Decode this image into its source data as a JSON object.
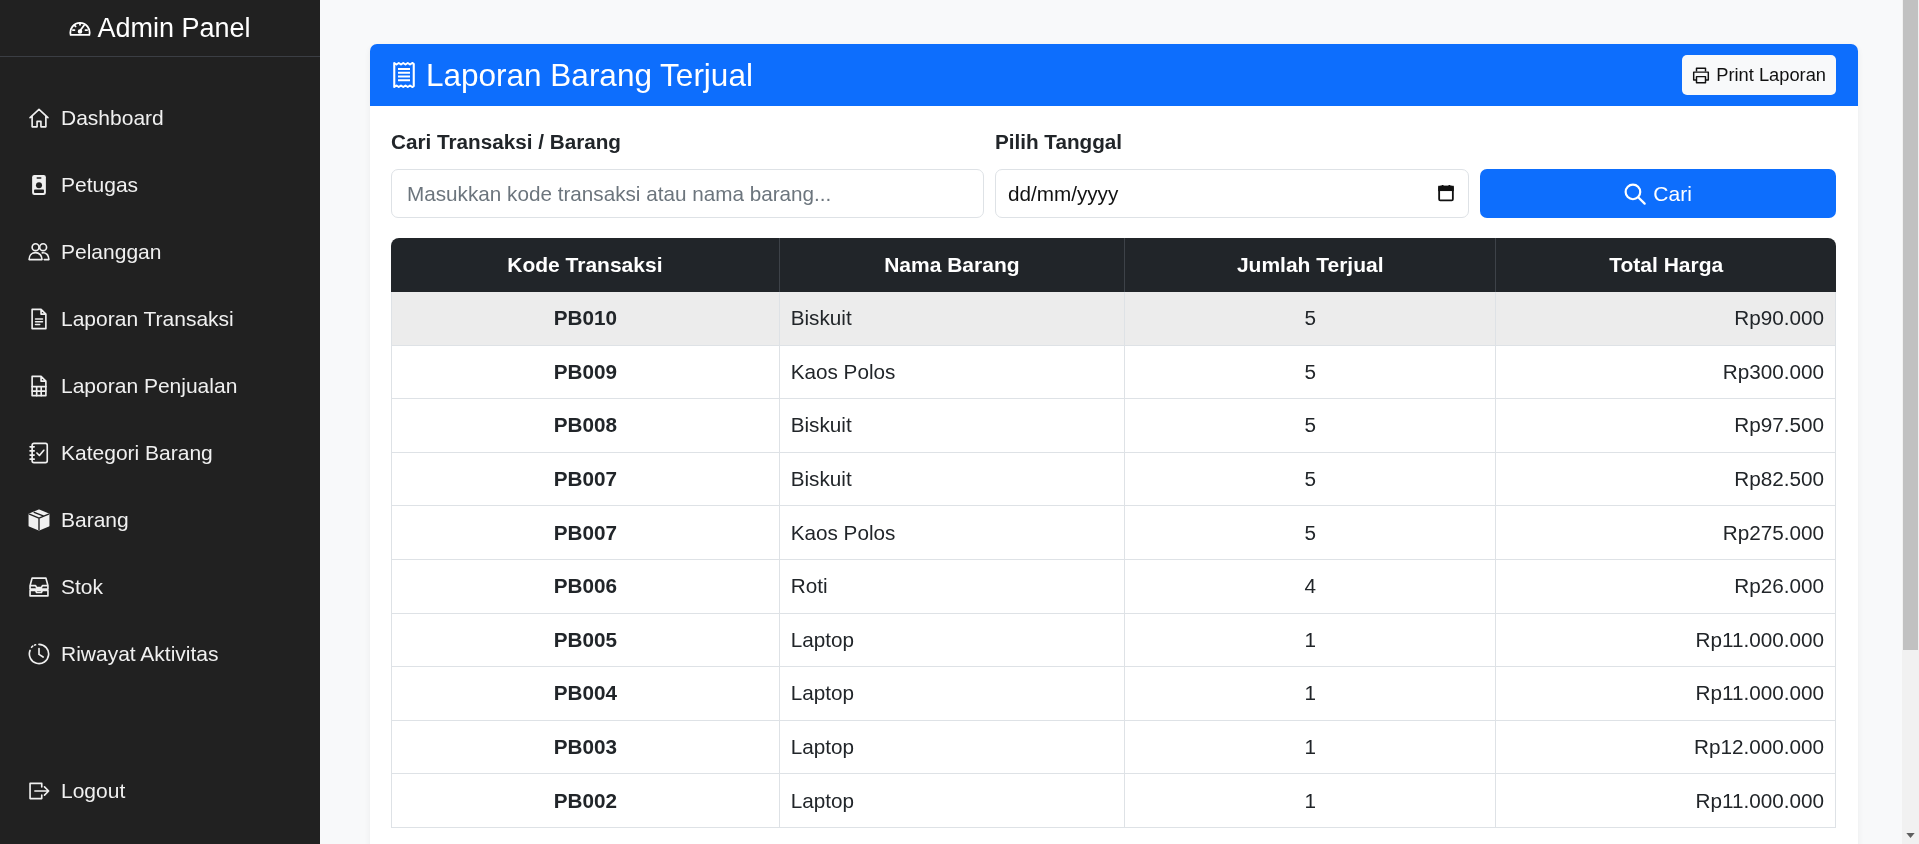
{
  "sidebar": {
    "brand": "Admin Panel",
    "items": [
      {
        "label": "Dashboard"
      },
      {
        "label": "Petugas"
      },
      {
        "label": "Pelanggan"
      },
      {
        "label": "Laporan Transaksi"
      },
      {
        "label": "Laporan Penjualan"
      },
      {
        "label": "Kategori Barang"
      },
      {
        "label": "Barang"
      },
      {
        "label": "Stok"
      },
      {
        "label": "Riwayat Aktivitas"
      }
    ],
    "logout": "Logout"
  },
  "report": {
    "title": "Laporan Barang Terjual",
    "print_button": "Print Laporan",
    "search": {
      "label": "Cari Transaksi / Barang",
      "placeholder": "Masukkan kode transaksi atau nama barang..."
    },
    "date": {
      "label": "Pilih Tanggal",
      "placeholder": "dd/mm/yyyy"
    },
    "search_button": "Cari",
    "table": {
      "columns": [
        "Kode Transaksi",
        "Nama Barang",
        "Jumlah Terjual",
        "Total Harga"
      ],
      "rows": [
        {
          "cells": [
            "PB010",
            "Biskuit",
            "5",
            "Rp90.000"
          ],
          "highlighted": true
        },
        {
          "cells": [
            "PB009",
            "Kaos Polos",
            "5",
            "Rp300.000"
          ],
          "highlighted": false
        },
        {
          "cells": [
            "PB008",
            "Biskuit",
            "5",
            "Rp97.500"
          ],
          "highlighted": false
        },
        {
          "cells": [
            "PB007",
            "Biskuit",
            "5",
            "Rp82.500"
          ],
          "highlighted": false
        },
        {
          "cells": [
            "PB007",
            "Kaos Polos",
            "5",
            "Rp275.000"
          ],
          "highlighted": false
        },
        {
          "cells": [
            "PB006",
            "Roti",
            "4",
            "Rp26.000"
          ],
          "highlighted": false
        },
        {
          "cells": [
            "PB005",
            "Laptop",
            "1",
            "Rp11.000.000"
          ],
          "highlighted": false
        },
        {
          "cells": [
            "PB004",
            "Laptop",
            "1",
            "Rp11.000.000"
          ],
          "highlighted": false
        },
        {
          "cells": [
            "PB003",
            "Laptop",
            "1",
            "Rp12.000.000"
          ],
          "highlighted": false
        },
        {
          "cells": [
            "PB002",
            "Laptop",
            "1",
            "Rp11.000.000"
          ],
          "highlighted": false
        }
      ]
    }
  }
}
